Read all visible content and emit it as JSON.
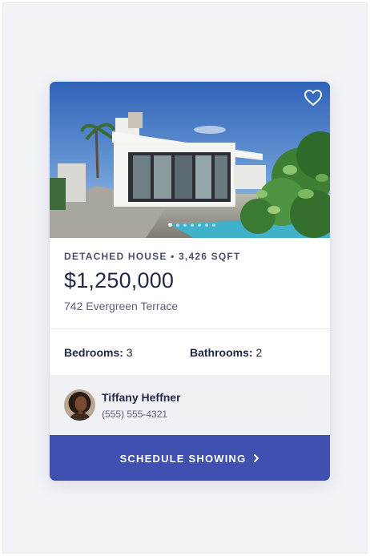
{
  "listing": {
    "meta": "DETACHED HOUSE • 3,426 SQFT",
    "price": "$1,250,000",
    "address": "742 Evergreen Terrace",
    "photo_count": 7,
    "active_photo_index": 0,
    "favorited": false
  },
  "rooms": {
    "bedrooms_label": "Bedrooms:",
    "bedrooms_value": "3",
    "bathrooms_label": "Bathrooms:",
    "bathrooms_value": "2"
  },
  "agent": {
    "name": "Tiffany Heffner",
    "phone": "(555) 555-4321"
  },
  "cta": {
    "label": "SCHEDULE SHOWING",
    "chevron_icon": "chevron-right-icon"
  },
  "icons": {
    "favorite": "heart-outline-icon"
  },
  "colors": {
    "accent": "#4050b0",
    "text_dark": "#222b45",
    "text_muted": "#5c627a",
    "page_bg": "#f2f3f7"
  }
}
